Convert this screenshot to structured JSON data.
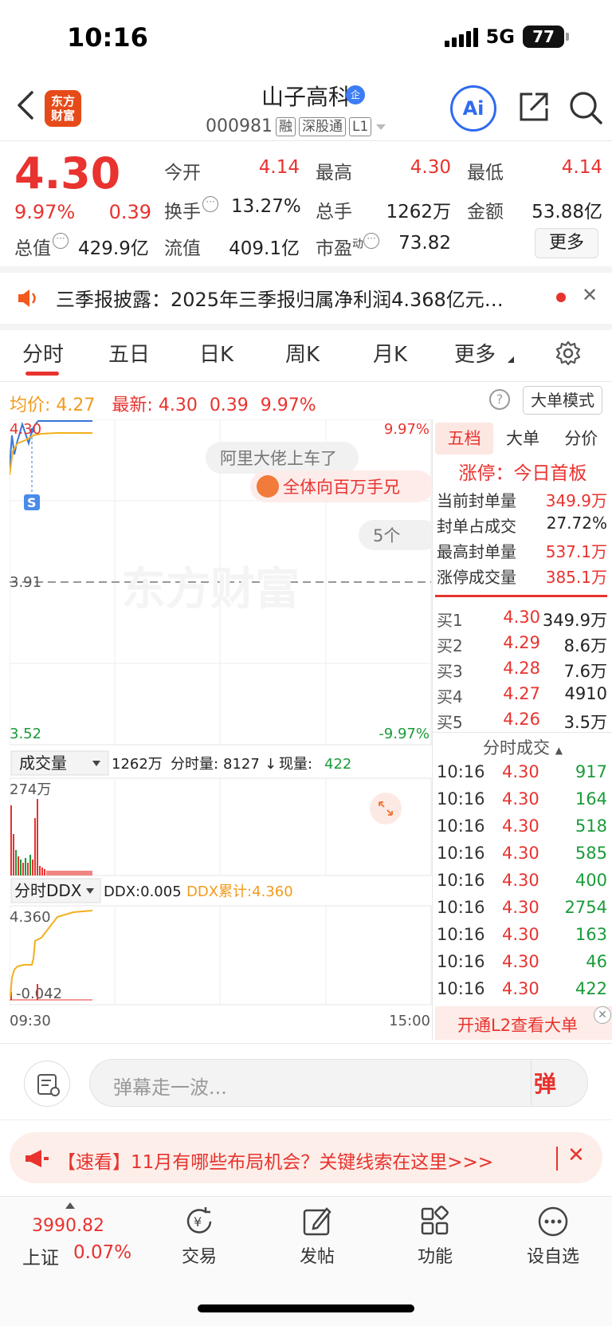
{
  "status_bar": {
    "time": "10:16",
    "network": "5G",
    "battery": "77"
  },
  "header": {
    "logo": "东方财富",
    "stock_name": "山子高科",
    "verify_badge": "企",
    "code": "000981",
    "tags": [
      "融",
      "深股通",
      "L1"
    ],
    "ai_label": "Ai"
  },
  "quote": {
    "price": "4.30",
    "change_pct": "9.97%",
    "change": "0.39",
    "market_cap_label": "总值",
    "market_cap": "429.9亿",
    "open_label": "今开",
    "open": "4.14",
    "high_label": "最高",
    "high": "4.30",
    "low_label": "最低",
    "low": "4.14",
    "turnover_label": "换手",
    "turnover": "13.27%",
    "volume_label": "总手",
    "volume": "1262万",
    "amount_label": "金额",
    "amount": "53.88亿",
    "float_cap_label": "流值",
    "float_cap": "409.1亿",
    "pe_label": "市盈",
    "pe_sup": "动",
    "pe": "73.82",
    "more_label": "更多"
  },
  "notice": {
    "text": "三季报披露：2025年三季报归属净利润4.368亿元…",
    "close": "✕"
  },
  "tabs": [
    {
      "label": "分时",
      "active": true
    },
    {
      "label": "五日"
    },
    {
      "label": "日K"
    },
    {
      "label": "周K"
    },
    {
      "label": "月K"
    },
    {
      "label": "更多"
    }
  ],
  "info_row": {
    "avg_label": "均价:",
    "avg": "4.27",
    "latest_label": "最新:",
    "latest": "4.30",
    "chg": "0.39",
    "pct": "9.97%",
    "help": "?",
    "mode_btn": "大单模式"
  },
  "chart": {
    "y_top": "4.30",
    "y_mid": "3.91",
    "y_bottom": "3.52",
    "pct_top": "9.97%",
    "pct_bottom": "-9.97%",
    "marker": "S",
    "bubble1": "阿里大佬上车了",
    "bubble2": "全体向百万手兄",
    "bubble3": "5个",
    "watermark": "东方财富",
    "vol_selector": "成交量",
    "vol_summary": "1262万",
    "vol_fs_label": "分时量:",
    "vol_fs": "8127",
    "vol_now_label": "现量:",
    "vol_now": "422",
    "vol_max": "274万",
    "ddx_selector": "分时DDX",
    "ddx": "DDX:0.005",
    "ddx_total": "DDX累计:4.360",
    "ddx_top": "4.360",
    "ddx_bottom": "-0.042",
    "time_start": "09:30",
    "time_end": "15:00"
  },
  "chart_data": {
    "type": "line",
    "title": "",
    "ylim": [
      3.52,
      4.3
    ],
    "series": [],
    "x": [
      "09:30",
      "15:00"
    ]
  },
  "right_panel": {
    "tabs": [
      "五档",
      "大单",
      "分价"
    ],
    "limit_title": "涨停：今日首板",
    "limit_rows": [
      {
        "label": "当前封单量",
        "value": "349.9万"
      },
      {
        "label": "封单占成交",
        "value": "27.72%"
      },
      {
        "label": "最高封单量",
        "value": "537.1万"
      },
      {
        "label": "涨停成交量",
        "value": "385.1万"
      }
    ],
    "bids": [
      {
        "label": "买1",
        "price": "4.30",
        "vol": "349.9万"
      },
      {
        "label": "买2",
        "price": "4.29",
        "vol": "8.6万"
      },
      {
        "label": "买3",
        "price": "4.28",
        "vol": "7.6万"
      },
      {
        "label": "买4",
        "price": "4.27",
        "vol": "4910"
      },
      {
        "label": "买5",
        "price": "4.26",
        "vol": "3.5万"
      }
    ],
    "trades_header": "分时成交",
    "trades": [
      {
        "t": "10:16",
        "p": "4.30",
        "v": "917"
      },
      {
        "t": "10:16",
        "p": "4.30",
        "v": "164"
      },
      {
        "t": "10:16",
        "p": "4.30",
        "v": "518"
      },
      {
        "t": "10:16",
        "p": "4.30",
        "v": "585"
      },
      {
        "t": "10:16",
        "p": "4.30",
        "v": "400"
      },
      {
        "t": "10:16",
        "p": "4.30",
        "v": "2754"
      },
      {
        "t": "10:16",
        "p": "4.30",
        "v": "163"
      },
      {
        "t": "10:16",
        "p": "4.30",
        "v": "46"
      },
      {
        "t": "10:16",
        "p": "4.30",
        "v": "422"
      }
    ],
    "l2_text": "开通L2查看大单"
  },
  "danmu": {
    "placeholder": "弹幕走一波...",
    "send": "弹"
  },
  "promo": {
    "text": "【速看】11月有哪些布局机会？关键线索在这里>>>",
    "close": "✕"
  },
  "bottom_nav": {
    "index_value": "3990.82",
    "index_name": "上证",
    "index_pct": "0.07%",
    "items": [
      "交易",
      "发帖",
      "功能",
      "设自选"
    ]
  },
  "colors": {
    "up": "#e8332f",
    "down": "#1a9b3a",
    "avg": "#f29b1d",
    "accent": "#2f6bf0"
  }
}
